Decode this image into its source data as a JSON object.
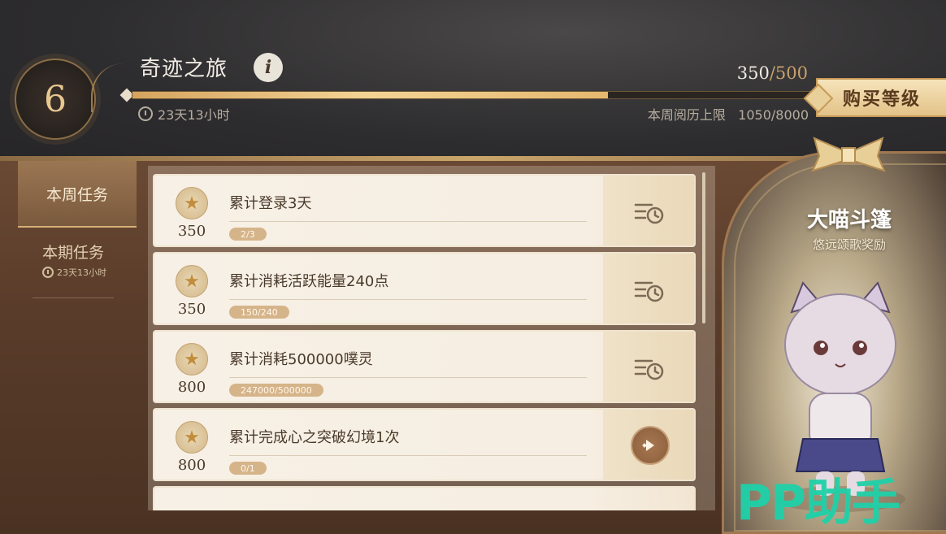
{
  "header": {
    "level": "6",
    "title": "奇迹之旅",
    "info_icon": "i",
    "xp_current": "350",
    "xp_max": "/500",
    "progress_fraction": 0.7,
    "timer": "23天13小时",
    "weekly_limit_label": "本周阅历上限",
    "weekly_limit_value": "1050/8000",
    "buy_label": "购买等级"
  },
  "tabs": {
    "weekly_label": "本周任务",
    "period_label": "本期任务",
    "period_timer": "23天13小时"
  },
  "tasks": [
    {
      "title": "累计登录3天",
      "points": "350",
      "progress": "2/3",
      "state": "pending"
    },
    {
      "title": "累计消耗活跃能量240点",
      "points": "350",
      "progress": "150/240",
      "state": "pending"
    },
    {
      "title": "累计消耗500000噗灵",
      "points": "800",
      "progress": "247000/500000",
      "state": "pending"
    },
    {
      "title": "累计完成心之突破幻境1次",
      "points": "800",
      "progress": "0/1",
      "state": "go"
    }
  ],
  "reward": {
    "name": "大喵斗篷",
    "subtitle": "悠远颂歌奖励"
  },
  "watermark": "PP助手",
  "icons": {
    "timer": "stopwatch-icon",
    "star": "double-star-icon",
    "pending": "list-clock-icon",
    "go": "arrow-right-icon"
  },
  "colors": {
    "accent_gold": "#e5b86e",
    "watermark": "#1fd1a9"
  }
}
